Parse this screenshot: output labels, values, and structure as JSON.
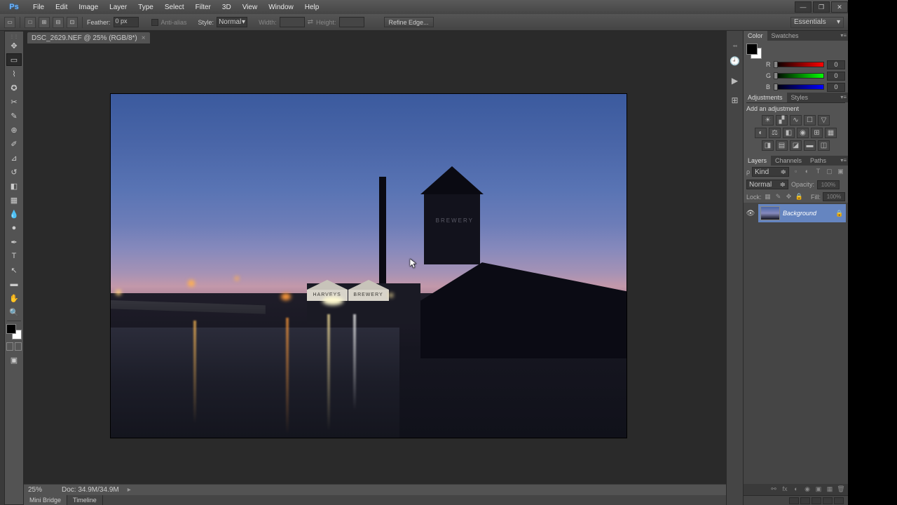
{
  "menu": [
    "File",
    "Edit",
    "Image",
    "Layer",
    "Type",
    "Select",
    "Filter",
    "3D",
    "View",
    "Window",
    "Help"
  ],
  "workspace_switcher": "Essentials",
  "app_logo": "Ps",
  "options": {
    "feather_label": "Feather:",
    "feather_value": "0 px",
    "antialias_label": "Anti-alias",
    "style_label": "Style:",
    "style_value": "Normal",
    "width_label": "Width:",
    "height_label": "Height:",
    "refine_label": "Refine Edge..."
  },
  "doc": {
    "tab_label": "DSC_2629.NEF @ 25% (RGB/8*)"
  },
  "status": {
    "zoom": "25%",
    "doc_info": "Doc: 34.9M/34.9M"
  },
  "bottom_tabs": [
    "Mini Bridge",
    "Timeline"
  ],
  "panels": {
    "color_tab": "Color",
    "swatches_tab": "Swatches",
    "rgb": {
      "r": "0",
      "g": "0",
      "b": "0"
    },
    "adjustments_tab": "Adjustments",
    "styles_tab": "Styles",
    "add_adjustment": "Add an adjustment",
    "layers_tab": "Layers",
    "channels_tab": "Channels",
    "paths_tab": "Paths",
    "kind_label": "Kind",
    "blend_mode": "Normal",
    "opacity_label": "Opacity:",
    "opacity_value": "100%",
    "lock_label": "Lock:",
    "fill_label": "Fill:",
    "fill_value": "100%",
    "background_name": "Background"
  },
  "sign": {
    "left": "HARVEYS",
    "right": "BREWERY",
    "tower": "BREWERY"
  }
}
